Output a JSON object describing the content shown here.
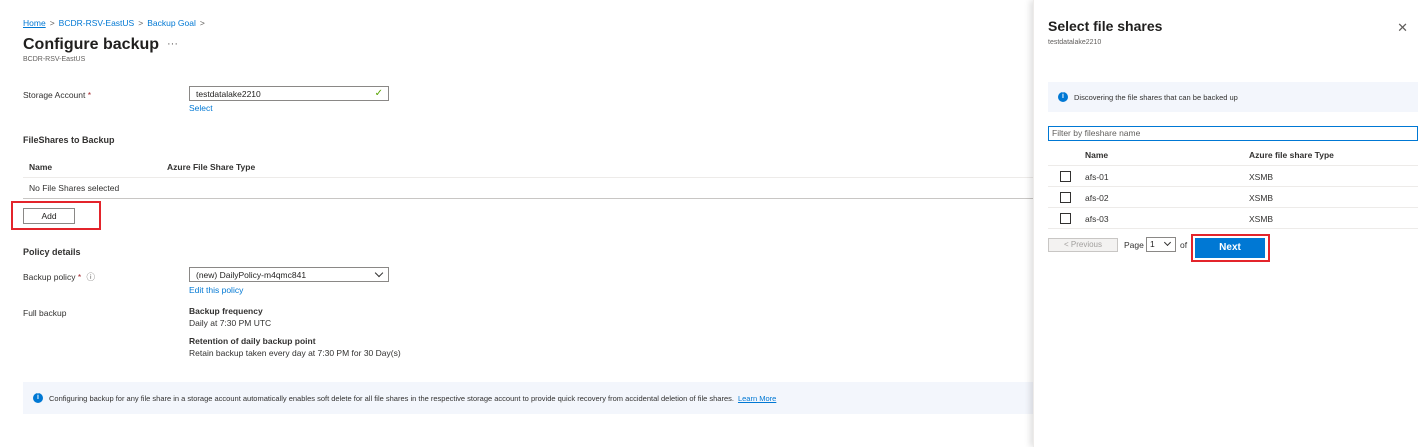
{
  "breadcrumb": {
    "home": "Home",
    "vault": "BCDR-RSV-EastUS",
    "goal": "Backup Goal",
    "sep": ">"
  },
  "page": {
    "title": "Configure backup",
    "more": "···",
    "subtitle": "BCDR-RSV-EastUS"
  },
  "storage": {
    "label": "Storage Account",
    "required": "*",
    "value": "testdatalake2210",
    "select_link": "Select"
  },
  "fileshares": {
    "heading": "FileShares to Backup",
    "col_name": "Name",
    "col_type": "Azure File Share Type",
    "empty_text": "No File Shares selected",
    "add_label": "Add"
  },
  "policy": {
    "heading": "Policy details",
    "label": "Backup policy",
    "required": "*",
    "info": "ⓘ",
    "value": "(new) DailyPolicy-m4qmc841",
    "edit_link": "Edit this policy",
    "full_backup_label": "Full backup",
    "freq_title": "Backup frequency",
    "freq_value": "Daily at 7:30 PM UTC",
    "retention_title": "Retention of daily backup point",
    "retention_value": "Retain backup taken every day at 7:30 PM for 30 Day(s)"
  },
  "info_banner": {
    "text": "Configuring backup for any file share in a storage account automatically enables soft delete for all file shares in the respective storage account to provide quick recovery from accidental deletion of file shares.",
    "learn_more": "Learn More"
  },
  "panel": {
    "title": "Select file shares",
    "subtitle": "testdatalake2210",
    "close": "✕",
    "banner": "Discovering the file shares that can be backed up",
    "filter_placeholder": "Filter by fileshare name",
    "col_name": "Name",
    "col_type": "Azure file share Type",
    "rows": [
      {
        "name": "afs-01",
        "type": "XSMB"
      },
      {
        "name": "afs-02",
        "type": "XSMB"
      },
      {
        "name": "afs-03",
        "type": "XSMB"
      }
    ],
    "prev_label": "< Previous",
    "page_label": "Page",
    "page_value": "1",
    "of_label": "of",
    "next_label": "Next"
  },
  "colors": {
    "accent": "#0078d4",
    "highlight": "#e3242b",
    "success": "#57a300"
  }
}
